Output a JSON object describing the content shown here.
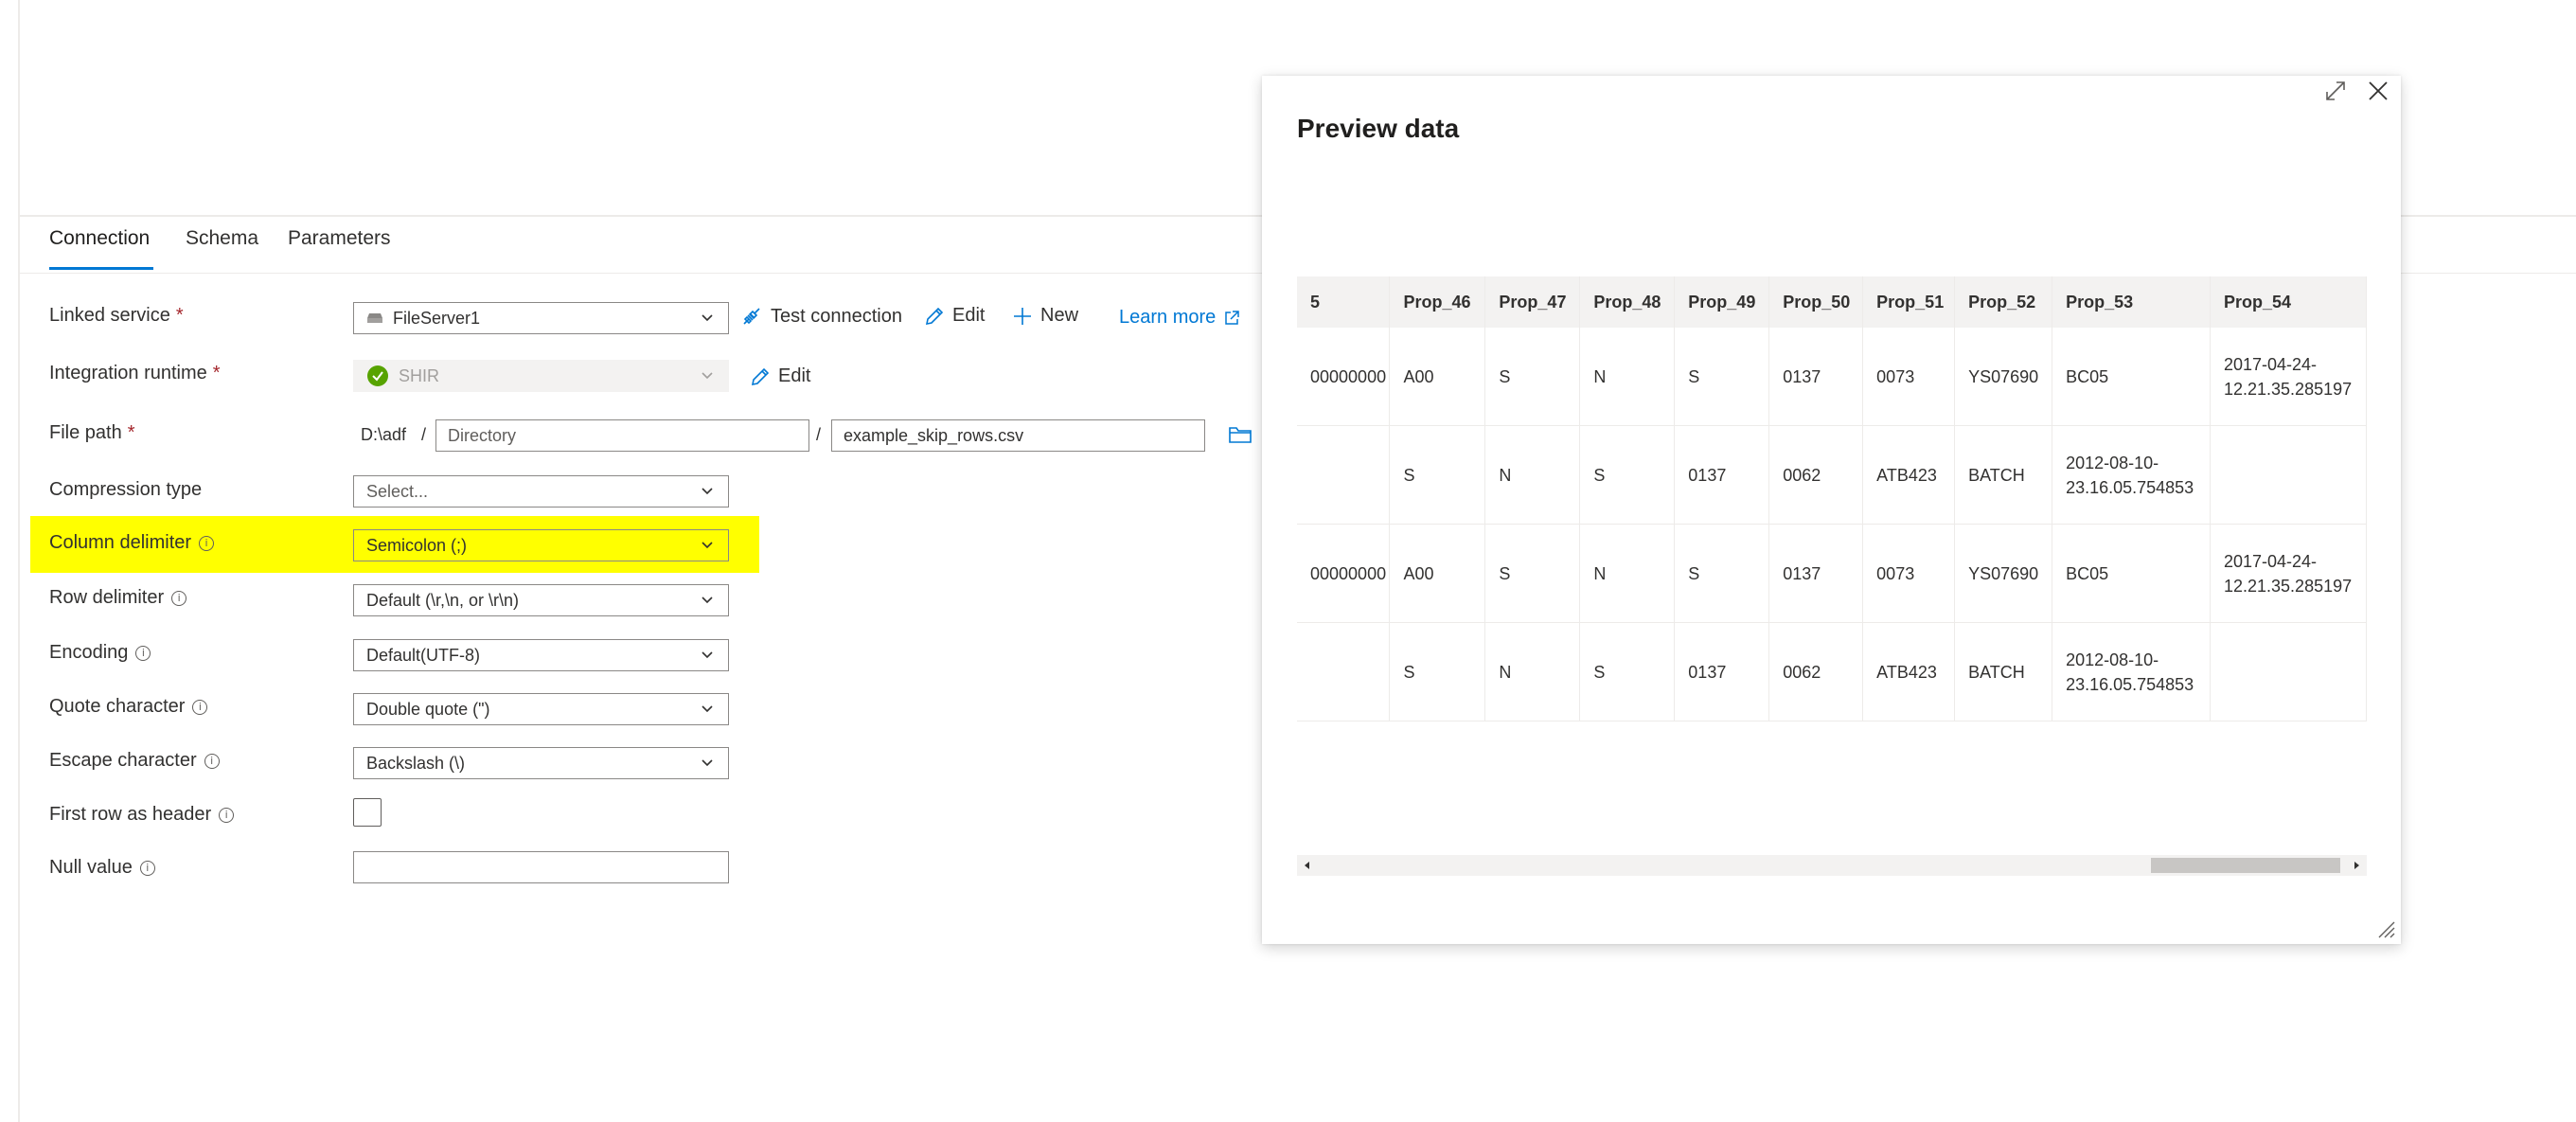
{
  "tabs": [
    "Connection",
    "Schema",
    "Parameters"
  ],
  "form": {
    "linked_service": {
      "label": "Linked service",
      "required": "*",
      "value": "FileServer1"
    },
    "test_connection": "Test connection",
    "edit": "Edit",
    "new": "New",
    "learn_more": "Learn more",
    "integration_runtime": {
      "label": "Integration runtime",
      "required": "*",
      "value": "SHIR",
      "edit": "Edit"
    },
    "file_path": {
      "label": "File path",
      "required": "*",
      "root": "D:\\adf",
      "sep": "/",
      "directory_placeholder": "Directory",
      "file": "example_skip_rows.csv"
    },
    "compression_type": {
      "label": "Compression type",
      "value": "Select..."
    },
    "column_delimiter": {
      "label": "Column delimiter",
      "value": "Semicolon (;)"
    },
    "row_delimiter": {
      "label": "Row delimiter",
      "value": "Default (\\r,\\n, or \\r\\n)"
    },
    "encoding": {
      "label": "Encoding",
      "value": "Default(UTF-8)"
    },
    "quote_character": {
      "label": "Quote character",
      "value": "Double quote (\")"
    },
    "escape_character": {
      "label": "Escape character",
      "value": "Backslash (\\)"
    },
    "first_row_header": {
      "label": "First row as header"
    },
    "null_value": {
      "label": "Null value",
      "value": ""
    }
  },
  "preview": {
    "title": "Preview data",
    "columns": [
      "5",
      "Prop_46",
      "Prop_47",
      "Prop_48",
      "Prop_49",
      "Prop_50",
      "Prop_51",
      "Prop_52",
      "Prop_53",
      "Prop_54"
    ],
    "rows": [
      [
        "00000000",
        "A00",
        "S",
        "N",
        "S",
        "0137",
        "0073",
        "YS07690",
        "BC05",
        "2017-04-24-\n12.21.35.285197"
      ],
      [
        "",
        "S",
        "N",
        "S",
        "0137",
        "0062",
        "ATB423",
        "BATCH",
        "2012-08-10-\n23.16.05.754853",
        ""
      ],
      [
        "00000000",
        "A00",
        "S",
        "N",
        "S",
        "0137",
        "0073",
        "YS07690",
        "BC05",
        "2017-04-24-\n12.21.35.285197"
      ],
      [
        "",
        "S",
        "N",
        "S",
        "0137",
        "0062",
        "ATB423",
        "BATCH",
        "2012-08-10-\n23.16.05.754853",
        ""
      ]
    ]
  },
  "colors": {
    "accent": "#0078d4",
    "highlight": "#ffff00",
    "success": "#57a300",
    "required": "#a4262c"
  }
}
